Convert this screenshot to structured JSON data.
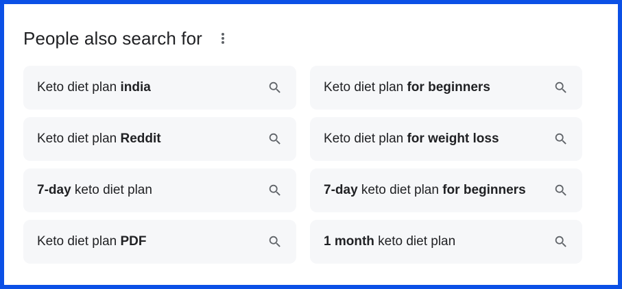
{
  "section": {
    "title": "People also search for",
    "more_icon": "more-vert-icon"
  },
  "suggestions": [
    {
      "parts": [
        {
          "text": "Keto diet plan ",
          "bold": false
        },
        {
          "text": "india",
          "bold": true
        }
      ]
    },
    {
      "parts": [
        {
          "text": "Keto diet plan ",
          "bold": false
        },
        {
          "text": "for beginners",
          "bold": true
        }
      ]
    },
    {
      "parts": [
        {
          "text": "Keto diet plan ",
          "bold": false
        },
        {
          "text": "Reddit",
          "bold": true
        }
      ]
    },
    {
      "parts": [
        {
          "text": "Keto diet plan ",
          "bold": false
        },
        {
          "text": "for weight loss",
          "bold": true
        }
      ]
    },
    {
      "parts": [
        {
          "text": "7-day",
          "bold": true
        },
        {
          "text": " keto diet plan",
          "bold": false
        }
      ]
    },
    {
      "parts": [
        {
          "text": "7-day",
          "bold": true
        },
        {
          "text": " keto diet plan ",
          "bold": false
        },
        {
          "text": "for beginners",
          "bold": true
        }
      ]
    },
    {
      "parts": [
        {
          "text": "Keto diet plan ",
          "bold": false
        },
        {
          "text": "PDF",
          "bold": true
        }
      ]
    },
    {
      "parts": [
        {
          "text": "1 month",
          "bold": true
        },
        {
          "text": " keto diet plan",
          "bold": false
        }
      ]
    }
  ],
  "colors": {
    "frame_border": "#0b50e6",
    "chip_background": "#f6f7f9",
    "text": "#202124",
    "icon": "#5f6368"
  },
  "icons": {
    "search": "search-icon"
  }
}
